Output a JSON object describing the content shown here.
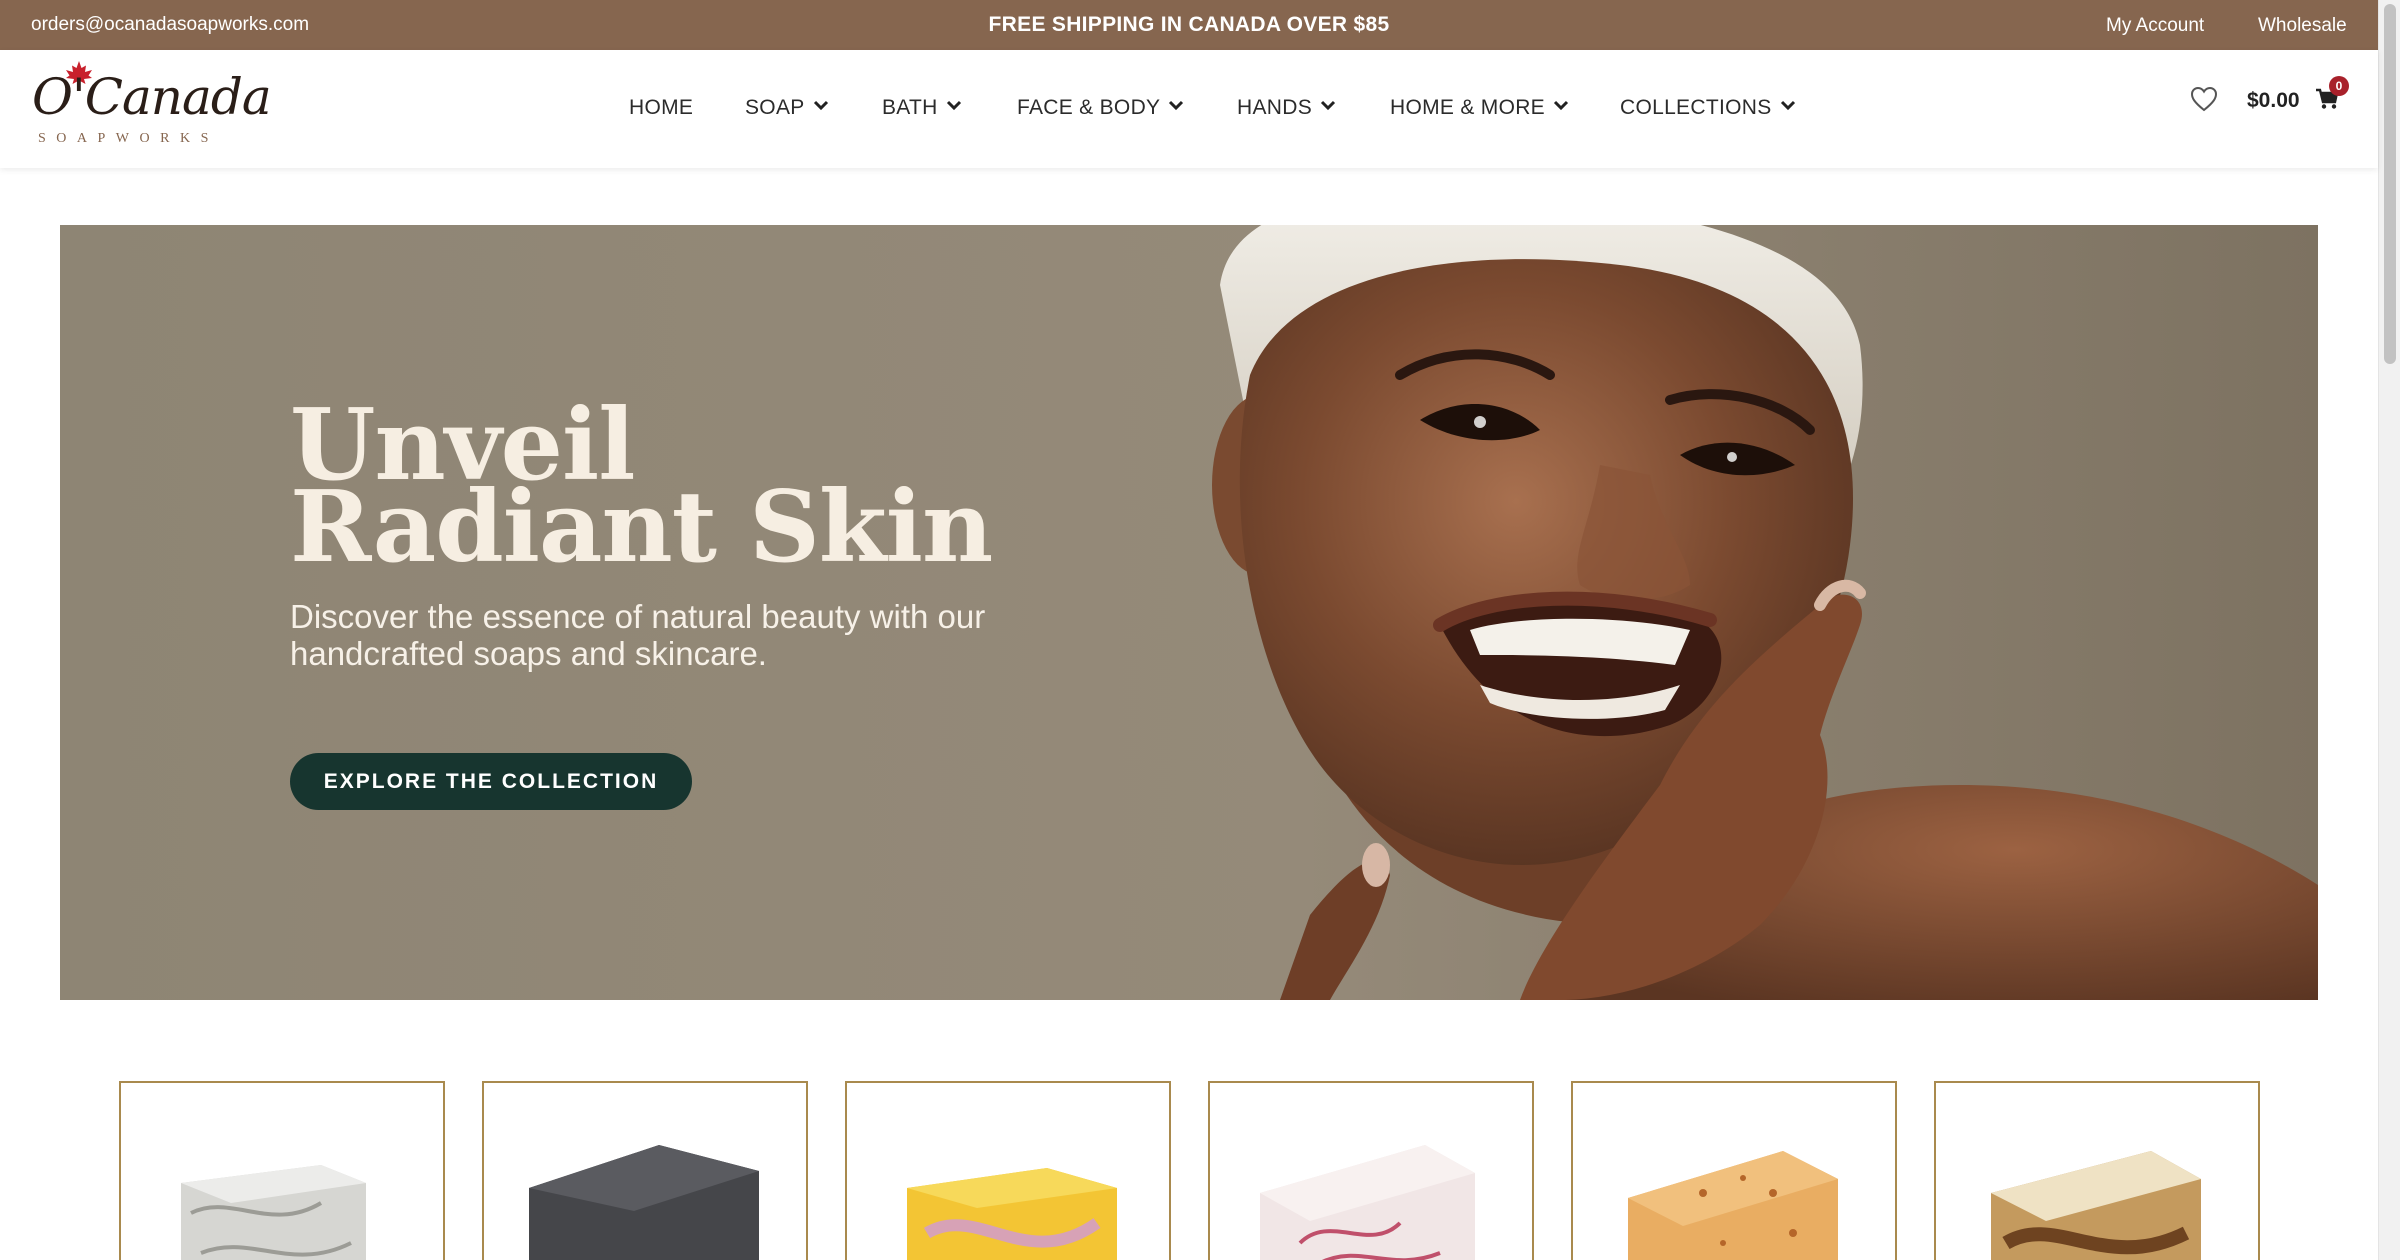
{
  "topbar": {
    "email": "orders@ocanadasoapworks.com",
    "promo": "FREE SHIPPING IN CANADA OVER $85",
    "account": "My Account",
    "wholesale": "Wholesale"
  },
  "brand": {
    "name": "O'Canada",
    "sub": "SOAPWORKS"
  },
  "nav": {
    "items": [
      {
        "label": "HOME"
      },
      {
        "label": "SOAP"
      },
      {
        "label": "BATH"
      },
      {
        "label": "FACE & BODY"
      },
      {
        "label": "HANDS"
      },
      {
        "label": "HOME & MORE"
      },
      {
        "label": "COLLECTIONS"
      }
    ]
  },
  "cart": {
    "total": "$0.00",
    "count": "0"
  },
  "hero": {
    "title_line1": "Unveil",
    "title_line2": "Radiant Skin",
    "subtitle": "Discover the essence of natural beauty with our handcrafted soaps and skincare.",
    "cta": "EXPLORE THE COLLECTION"
  },
  "products": [
    {
      "icon": "marble-soap-image",
      "color": "#d9d9d6"
    },
    {
      "icon": "charcoal-soap-image",
      "color": "#45464a"
    },
    {
      "icon": "citrus-soap-image",
      "color": "#f3c534"
    },
    {
      "icon": "rose-swirl-soap-image",
      "color": "#f1e6e6"
    },
    {
      "icon": "calendula-soap-image",
      "color": "#e9ad62"
    },
    {
      "icon": "coffee-swirl-soap-image",
      "color": "#c49a5e"
    }
  ],
  "colors": {
    "topbar": "#86664f",
    "accent": "#17352f",
    "card_border": "#a98a4e",
    "badge": "#a8212b"
  }
}
